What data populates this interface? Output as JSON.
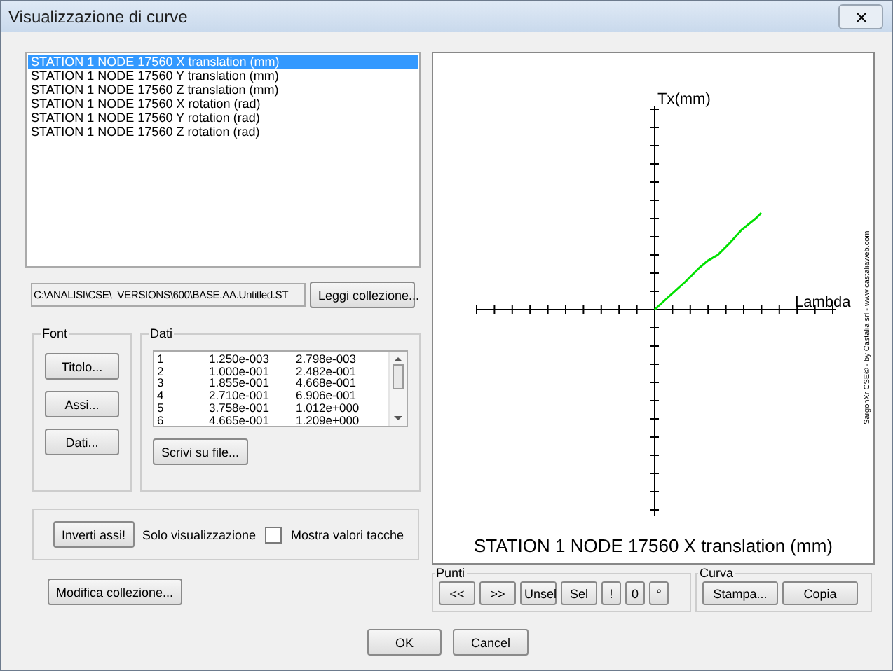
{
  "window": {
    "title": "Visualizzazione di curve"
  },
  "curves": [
    {
      "label": "STATION 1 NODE 17560  X translation (mm)",
      "selected": true
    },
    {
      "label": "STATION 1 NODE 17560  Y translation (mm)",
      "selected": false
    },
    {
      "label": "STATION 1 NODE 17560  Z translation (mm)",
      "selected": false
    },
    {
      "label": "STATION 1 NODE 17560  X rotation (rad)",
      "selected": false
    },
    {
      "label": "STATION 1 NODE 17560  Y rotation (rad)",
      "selected": false
    },
    {
      "label": "STATION 1 NODE 17560  Z rotation (rad)",
      "selected": false
    }
  ],
  "path": {
    "value": "C:\\ANALISI\\CSE\\_VERSIONS\\600\\BASE.AA.Untitled.ST"
  },
  "load_button": "Leggi collezione...",
  "font_group": {
    "title": "Font",
    "buttons": [
      "Titolo...",
      "Assi...",
      "Dati..."
    ]
  },
  "data_group": {
    "title": "Dati",
    "rows": [
      [
        "1",
        "1.250e-003",
        "2.798e-003"
      ],
      [
        "2",
        "1.000e-001",
        "2.482e-001"
      ],
      [
        "3",
        "1.855e-001",
        "4.668e-001"
      ],
      [
        "4",
        "2.710e-001",
        "6.906e-001"
      ],
      [
        "5",
        "3.758e-001",
        "1.012e+000"
      ],
      [
        "6",
        "4.665e-001",
        "1.209e+000"
      ]
    ],
    "button": "Scrivi su file..."
  },
  "options": {
    "invert_button": "Inverti assi!",
    "mode_label": "Solo visualizzazione",
    "show_tick_values": {
      "label": "Mostra valori tacche",
      "checked": false
    }
  },
  "edit_button": "Modifica collezione...",
  "plot": {
    "y_label": "Tx(mm)",
    "x_label": "Lambda",
    "credit": "SargonXr CSE© - by Castalia srl - www.castaliaweb.com",
    "title": "STATION 1 NODE 17560  X translation (mm)"
  },
  "points_group": {
    "title": "Punti",
    "buttons": [
      "<<",
      ">>",
      "Unsel",
      "Sel",
      "!",
      "0",
      "°"
    ]
  },
  "curve_group": {
    "title": "Curva",
    "buttons": [
      "Stampa...",
      "Copia"
    ]
  },
  "dialog_buttons": [
    "OK",
    "Cancel"
  ]
}
